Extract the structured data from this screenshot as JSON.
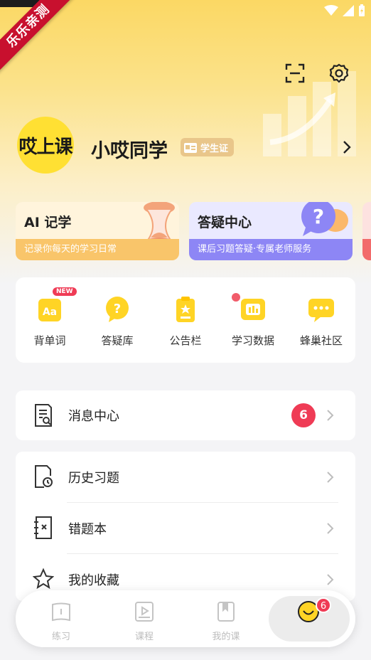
{
  "ribbon": "乐乐亲测",
  "profile": {
    "avatar_text": "哎上课",
    "name": "小哎同学",
    "badge": "学生证"
  },
  "cards": [
    {
      "title": "AI 记学",
      "subtitle": "记录你每天的学习日常"
    },
    {
      "title": "答疑中心",
      "subtitle": "课后习题答疑·专属老师服务"
    }
  ],
  "tools": [
    {
      "label": "背单词",
      "badge": "NEW",
      "icon": "aa-card-icon"
    },
    {
      "label": "答疑库",
      "icon": "question-bubble-icon"
    },
    {
      "label": "公告栏",
      "icon": "clipboard-icon"
    },
    {
      "label": "学习数据",
      "icon": "data-screen-icon"
    },
    {
      "label": "蜂巢社区",
      "icon": "chat-dots-icon"
    }
  ],
  "message_row": {
    "label": "消息中心",
    "count": "6"
  },
  "list_rows": [
    {
      "label": "历史习题",
      "icon": "history-doc-icon"
    },
    {
      "label": "错题本",
      "icon": "mistake-book-icon"
    },
    {
      "label": "我的收藏",
      "icon": "star-icon"
    }
  ],
  "tabbar": {
    "tabs": [
      {
        "label": "练习",
        "icon": "practice-book-icon"
      },
      {
        "label": "课程",
        "icon": "course-play-icon"
      },
      {
        "label": "我的课",
        "icon": "my-course-icon"
      },
      {
        "label": "",
        "icon": "smiley-icon"
      }
    ],
    "badge": "6"
  },
  "colors": {
    "accent_yellow": "#fbd864",
    "badge_red": "#ef3b55",
    "purple": "#8d86f5",
    "orange": "#f9c56a"
  }
}
